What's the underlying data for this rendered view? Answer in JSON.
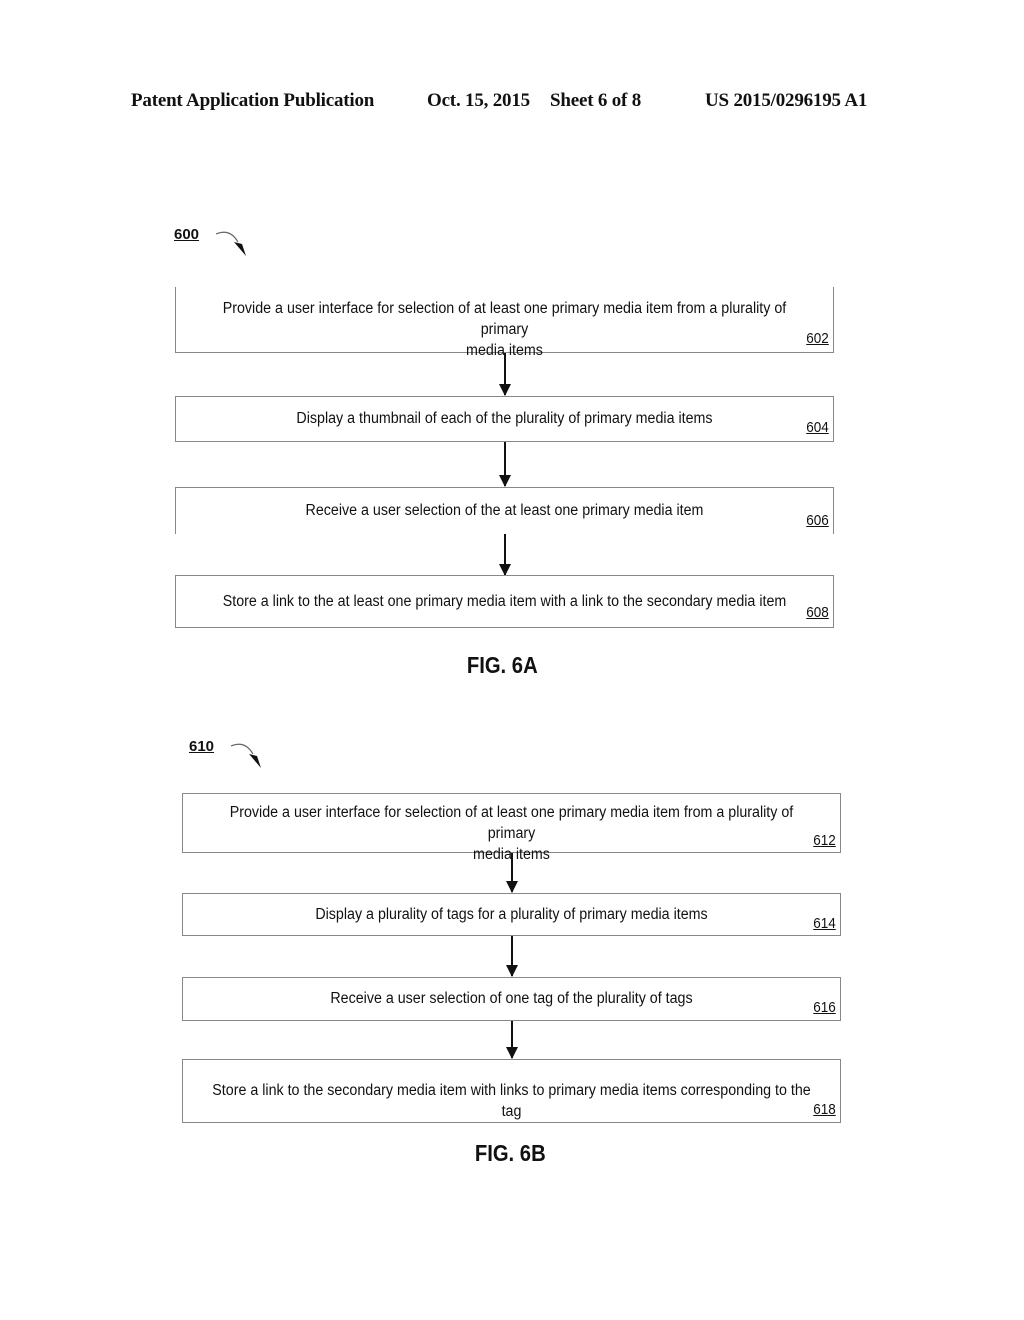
{
  "header": {
    "publication": "Patent Application Publication",
    "date": "Oct. 15, 2015",
    "sheet": "Sheet 6 of 8",
    "number": "US 2015/0296195 A1"
  },
  "fig6a": {
    "ref": "600",
    "caption": "FIG. 6A",
    "steps": [
      {
        "text_line1": "Provide a user interface for selection of at least one primary media item from a plurality of primary",
        "text_line2": "media items",
        "num": "602"
      },
      {
        "text_line1": "Display a thumbnail of each of the plurality of primary media items",
        "num": "604"
      },
      {
        "text_line1": "Receive a user selection of the at least one primary media item",
        "num": "606"
      },
      {
        "text_line1": "Store a link to the at least one primary media item with a link to the secondary media item",
        "num": "608"
      }
    ]
  },
  "fig6b": {
    "ref": "610",
    "caption": "FIG. 6B",
    "steps": [
      {
        "text_line1": "Provide a user interface for selection of at least one primary media item from a plurality of primary",
        "text_line2": "media items",
        "num": "612"
      },
      {
        "text_line1": "Display a plurality of tags for a plurality of primary media items",
        "num": "614"
      },
      {
        "text_line1": "Receive a user selection of one tag of the plurality of tags",
        "num": "616"
      },
      {
        "text_line1": "Store a link to the secondary media item with links to primary media items corresponding to the tag",
        "num": "618"
      }
    ]
  }
}
